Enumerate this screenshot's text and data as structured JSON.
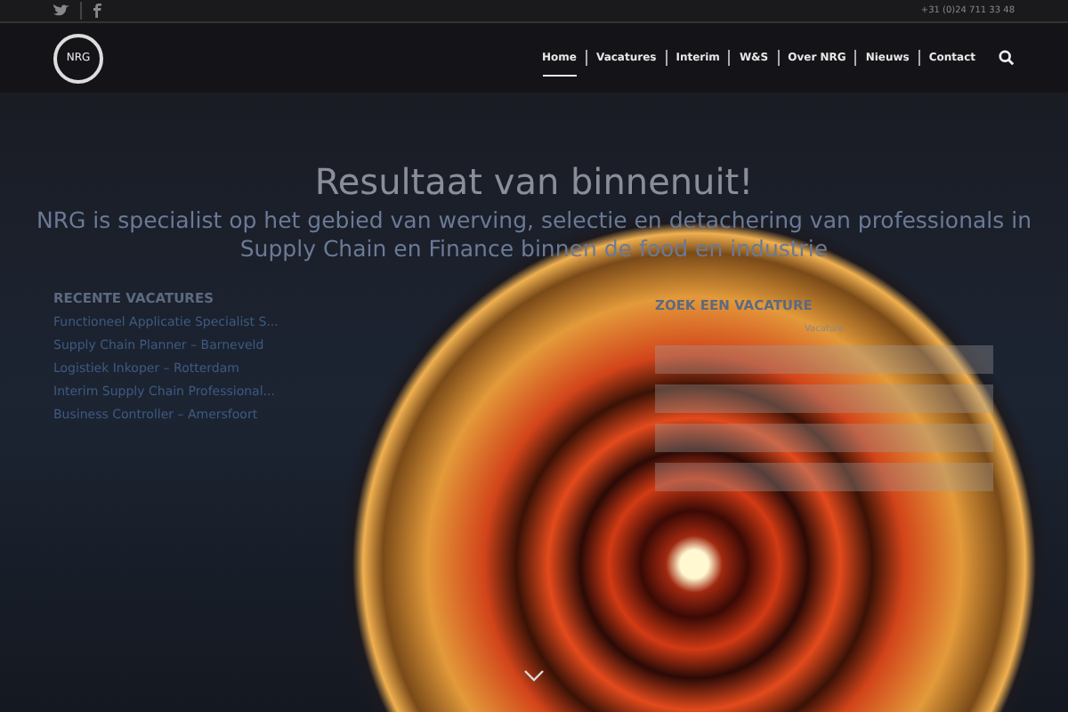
{
  "topbar": {
    "phone": "+31 (0)24 711 33 48"
  },
  "header": {
    "logo": "NRG",
    "nav": [
      {
        "label": "Home",
        "selected": true
      },
      {
        "label": "Vacatures",
        "selected": false
      },
      {
        "label": "Interim",
        "selected": false
      },
      {
        "label": "W&S",
        "selected": false
      },
      {
        "label": "Over NRG",
        "selected": false
      },
      {
        "label": "Nieuws",
        "selected": false
      },
      {
        "label": "Contact",
        "selected": false
      }
    ]
  },
  "hero": {
    "title": "Resultaat van binnenuit!",
    "subtitle": "NRG is specialist op het gebied van werving, selectie en detachering van professionals in Supply Chain en Finance binnen de food en industrie"
  },
  "recent": {
    "heading": "RECENTE VACATURES",
    "items": [
      "Functioneel Applicatie Specialist S...",
      "Supply Chain Planner – Barneveld",
      "Logistiek Inkoper – Rotterdam",
      "Interim Supply Chain Professional...",
      "Business Controller – Amersfoort"
    ]
  },
  "search_form": {
    "heading": "ZOEK EEN VACATURE",
    "label": "Vacature"
  }
}
